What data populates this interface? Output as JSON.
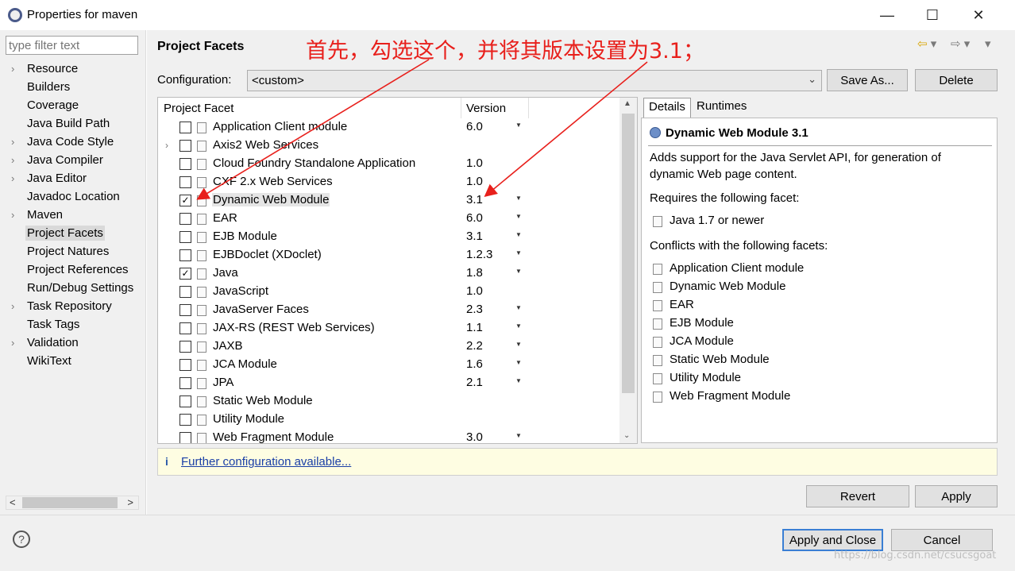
{
  "window": {
    "title": "Properties for maven",
    "minimize": "—",
    "maximize": "☐",
    "close": "✕"
  },
  "left": {
    "filter_placeholder": "type filter text",
    "items": [
      {
        "label": "Resource",
        "arrow": true
      },
      {
        "label": "Builders",
        "arrow": false
      },
      {
        "label": "Coverage",
        "arrow": false
      },
      {
        "label": "Java Build Path",
        "arrow": false
      },
      {
        "label": "Java Code Style",
        "arrow": true
      },
      {
        "label": "Java Compiler",
        "arrow": true
      },
      {
        "label": "Java Editor",
        "arrow": true
      },
      {
        "label": "Javadoc Location",
        "arrow": false
      },
      {
        "label": "Maven",
        "arrow": true
      },
      {
        "label": "Project Facets",
        "arrow": false,
        "selected": true
      },
      {
        "label": "Project Natures",
        "arrow": false
      },
      {
        "label": "Project References",
        "arrow": false
      },
      {
        "label": "Run/Debug Settings",
        "arrow": false
      },
      {
        "label": "Task Repository",
        "arrow": true
      },
      {
        "label": "Task Tags",
        "arrow": false
      },
      {
        "label": "Validation",
        "arrow": true
      },
      {
        "label": "WikiText",
        "arrow": false
      }
    ]
  },
  "page": {
    "title": "Project Facets",
    "annotation": "首先，勾选这个，并将其版本设置为3.1；",
    "config_label": "Configuration:",
    "config_value": "<custom>",
    "save_as": "Save As...",
    "delete": "Delete"
  },
  "facets": {
    "col_facet": "Project Facet",
    "col_version": "Version",
    "rows": [
      {
        "name": "Application Client module",
        "version": "6.0",
        "dropdown": true,
        "checked": false,
        "expand": false
      },
      {
        "name": "Axis2 Web Services",
        "version": "",
        "dropdown": false,
        "checked": false,
        "expand": true
      },
      {
        "name": "Cloud Foundry Standalone Application",
        "version": "1.0",
        "dropdown": false,
        "checked": false,
        "expand": false
      },
      {
        "name": "CXF 2.x Web Services",
        "version": "1.0",
        "dropdown": false,
        "checked": false,
        "expand": false
      },
      {
        "name": "Dynamic Web Module",
        "version": "3.1",
        "dropdown": true,
        "checked": true,
        "expand": false,
        "highlight": true
      },
      {
        "name": "EAR",
        "version": "6.0",
        "dropdown": true,
        "checked": false,
        "expand": false
      },
      {
        "name": "EJB Module",
        "version": "3.1",
        "dropdown": true,
        "checked": false,
        "expand": false
      },
      {
        "name": "EJBDoclet (XDoclet)",
        "version": "1.2.3",
        "dropdown": true,
        "checked": false,
        "expand": false
      },
      {
        "name": "Java",
        "version": "1.8",
        "dropdown": true,
        "checked": true,
        "expand": false
      },
      {
        "name": "JavaScript",
        "version": "1.0",
        "dropdown": false,
        "checked": false,
        "expand": false
      },
      {
        "name": "JavaServer Faces",
        "version": "2.3",
        "dropdown": true,
        "checked": false,
        "expand": false
      },
      {
        "name": "JAX-RS (REST Web Services)",
        "version": "1.1",
        "dropdown": true,
        "checked": false,
        "expand": false
      },
      {
        "name": "JAXB",
        "version": "2.2",
        "dropdown": true,
        "checked": false,
        "expand": false
      },
      {
        "name": "JCA Module",
        "version": "1.6",
        "dropdown": true,
        "checked": false,
        "expand": false
      },
      {
        "name": "JPA",
        "version": "2.1",
        "dropdown": true,
        "checked": false,
        "expand": false
      },
      {
        "name": "Static Web Module",
        "version": "",
        "dropdown": false,
        "checked": false,
        "expand": false
      },
      {
        "name": "Utility Module",
        "version": "",
        "dropdown": false,
        "checked": false,
        "expand": false
      },
      {
        "name": "Web Fragment Module",
        "version": "3.0",
        "dropdown": true,
        "checked": false,
        "expand": false
      }
    ]
  },
  "details": {
    "tab_details": "Details",
    "tab_runtimes": "Runtimes",
    "title": "Dynamic Web Module 3.1",
    "desc1": "Adds support for the Java Servlet API, for generation of",
    "desc2": "dynamic Web page content.",
    "requires_label": "Requires the following facet:",
    "requires": [
      "Java 1.7 or newer"
    ],
    "conflicts_label": "Conflicts with the following facets:",
    "conflicts": [
      "Application Client module",
      "Dynamic Web Module",
      "EAR",
      "EJB Module",
      "JCA Module",
      "Static Web Module",
      "Utility Module",
      "Web Fragment Module"
    ]
  },
  "info": {
    "icon": "i",
    "link": "Further configuration available..."
  },
  "buttons": {
    "revert": "Revert",
    "apply": "Apply",
    "apply_close": "Apply and Close",
    "cancel": "Cancel",
    "help": "?"
  },
  "watermark": "https://blog.csdn.net/csucsgoat",
  "colors": {
    "annotation": "#e8201c",
    "link": "#1a3fa6",
    "info_bg": "#fefde2"
  }
}
